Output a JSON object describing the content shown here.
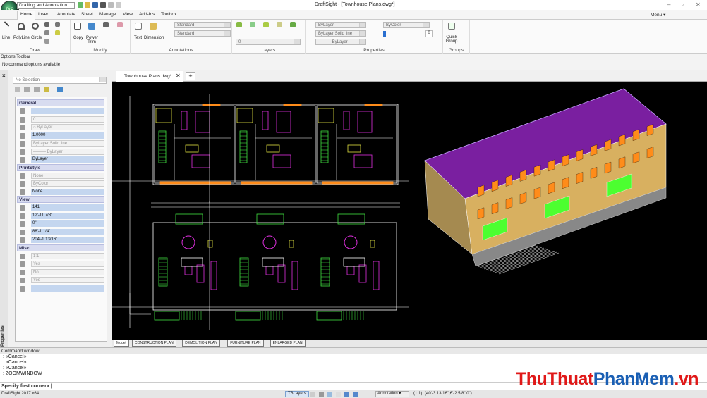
{
  "app": {
    "title": "DraftSight - [Townhouse Plans.dwg*]",
    "logo_text": "DS",
    "workspace": "Drafting and Annotation"
  },
  "window_controls": {
    "minimize": "–",
    "restore": "▫",
    "close": "✕"
  },
  "menu": {
    "label": "Menu ▾"
  },
  "ribbon_tabs": [
    "Home",
    "Insert",
    "Annotate",
    "Sheet",
    "Manage",
    "View",
    "Add-Ins",
    "Toolbox"
  ],
  "groups": {
    "draw": {
      "label": "Draw",
      "buttons": [
        "Line",
        "PolyLine",
        "Circle"
      ]
    },
    "modify": {
      "label": "Modify",
      "buttons": [
        "Copy",
        "Power Trim"
      ]
    },
    "annotations": {
      "label": "Annotations",
      "buttons": [
        "Text",
        "Dimension"
      ],
      "text_style": "Standard",
      "dim_style": "Standard"
    },
    "layers": {
      "label": "Layers",
      "layer": "0"
    },
    "properties": {
      "label": "Properties",
      "color": "ByLayer",
      "linestyle": "ByLayer    Solid line",
      "lineweight": "——— ByLayer",
      "printstyle": "ByColor",
      "transparency": "0"
    },
    "groups": {
      "label": "Groups",
      "buttons": [
        "Quick Group"
      ]
    }
  },
  "options_toolbar": {
    "title": "Options Toolbar",
    "message": "No command options available"
  },
  "properties_panel": {
    "selection": "No Selection",
    "side_label": "Properties",
    "sections": [
      {
        "title": "General",
        "rows": [
          {
            "v": "",
            "s": "blue"
          },
          {
            "v": "0",
            "s": "grey"
          },
          {
            "v": "○ ByLayer",
            "s": "grey"
          },
          {
            "v": "1.0000",
            "s": "blue"
          },
          {
            "v": "ByLayer    Solid line",
            "s": "grey"
          },
          {
            "v": "——— ByLayer",
            "s": "grey"
          },
          {
            "v": "ByLayer",
            "s": "blue"
          }
        ]
      },
      {
        "title": "PrintStyle",
        "rows": [
          {
            "v": "None",
            "s": "grey"
          },
          {
            "v": "ByColor",
            "s": "grey"
          },
          {
            "v": "None",
            "s": "blue"
          }
        ]
      },
      {
        "title": "View",
        "rows": [
          {
            "v": "141'",
            "s": "blue"
          },
          {
            "v": "12'-11 7/8\"",
            "s": "blue"
          },
          {
            "v": "0\"",
            "s": "blue"
          },
          {
            "v": "88'-1 1/4\"",
            "s": "blue"
          },
          {
            "v": "204'-1 13/16\"",
            "s": "blue"
          }
        ]
      },
      {
        "title": "Misc",
        "rows": [
          {
            "v": "1:1",
            "s": "grey"
          },
          {
            "v": "Yes",
            "s": "grey"
          },
          {
            "v": "No",
            "s": "grey"
          },
          {
            "v": "Yes",
            "s": "grey"
          },
          {
            "v": "",
            "s": "blue"
          }
        ]
      }
    ]
  },
  "document": {
    "tab": "Townhouse Plans.dwg*",
    "close": "✕",
    "new": "+"
  },
  "layout_tabs": [
    "Model",
    "CONSTRUCTION PLAN",
    "DEMOLITION PLAN",
    "FURNITURE PLAN",
    "ENLARGED PLAN"
  ],
  "command_window": {
    "title": "Command window",
    "history": [
      ": «Cancel»",
      ": «Cancel»",
      ": «Cancel»",
      ": ZOOMWINDOW"
    ],
    "prompt": "Specify first corner»"
  },
  "status_bar": {
    "version": "DraftSight 2017 x64",
    "tblayers": "TBLayers",
    "annotation": "Annotation ▾",
    "scale": "(1:1)",
    "coords": "(40'-3 13/16\",6'-2 5/8\",0\")"
  },
  "watermark": {
    "part1": "ThuThuat",
    "part2": "PhanMem",
    "part3": ".vn"
  },
  "colors": {
    "canvas": "#000000",
    "roof": "#7a1fa0",
    "walls": "#d8b060",
    "windows": "#ff8c1a",
    "balcony": "#4cff30",
    "plan_white": "#ffffff",
    "plan_magenta": "#e030e0",
    "plan_green": "#40e040",
    "plan_yellow": "#e0e040",
    "plan_cyan": "#40e0e0",
    "watermark_red": "#e01818",
    "watermark_blue": "#1a5fb4"
  }
}
